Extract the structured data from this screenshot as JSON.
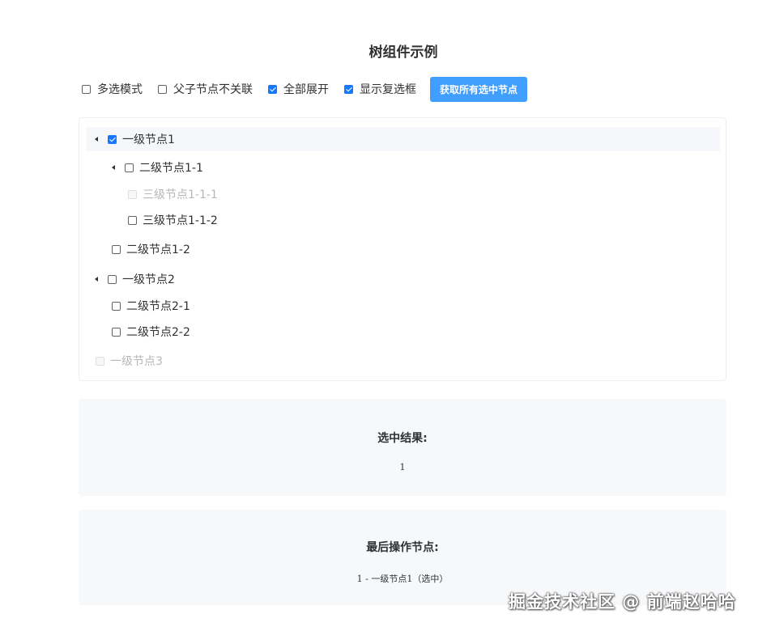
{
  "page": {
    "title": "树组件示例"
  },
  "controls": {
    "options": [
      {
        "label": "多选模式",
        "checked": false
      },
      {
        "label": "父子节点不关联",
        "checked": false
      },
      {
        "label": "全部展开",
        "checked": true
      },
      {
        "label": "显示复选框",
        "checked": true
      }
    ],
    "get_checked_button": "获取所有选中节点"
  },
  "tree": {
    "nodes": [
      {
        "label": "一级节点1",
        "level": 1,
        "expanded": true,
        "checked": true,
        "disabled": false,
        "selected": true
      },
      {
        "label": "二级节点1-1",
        "level": 2,
        "expanded": true,
        "checked": false,
        "disabled": false
      },
      {
        "label": "三级节点1-1-1",
        "level": 3,
        "checked": false,
        "disabled": true
      },
      {
        "label": "三级节点1-1-2",
        "level": 3,
        "checked": false,
        "disabled": false
      },
      {
        "label": "二级节点1-2",
        "level": 2,
        "checked": false,
        "disabled": false
      },
      {
        "label": "一级节点2",
        "level": 1,
        "expanded": true,
        "checked": false,
        "disabled": false
      },
      {
        "label": "二级节点2-1",
        "level": 2,
        "checked": false,
        "disabled": false
      },
      {
        "label": "二级节点2-2",
        "level": 2,
        "checked": false,
        "disabled": false
      },
      {
        "label": "一级节点3",
        "level": 1,
        "checked": false,
        "disabled": true
      }
    ]
  },
  "result": {
    "title": "选中结果:",
    "value": "1"
  },
  "last_operation": {
    "title": "最后操作节点:",
    "value": "1 - 一级节点1（选中）"
  },
  "watermark": "掘金技术社区 @ 前端赵哈哈",
  "colors": {
    "primary": "#409eff",
    "checkbox_checked": "#1677ff",
    "panel_bg": "#f7f8fa"
  }
}
